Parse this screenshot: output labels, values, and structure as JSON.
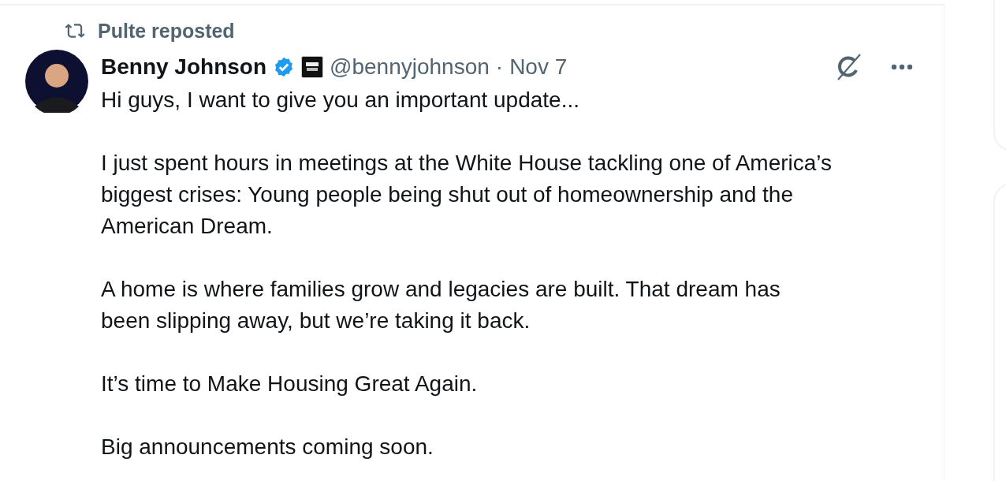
{
  "repost": {
    "text": "Pulte reposted"
  },
  "post": {
    "author": "Benny Johnson",
    "verified": true,
    "handle": "@bennyjohnson",
    "separator": "·",
    "date": "Nov 7",
    "paragraphs": [
      "Hi guys, I want to give you an important update...",
      "I just spent hours in meetings at the White House tackling one of America’s biggest crises: Young people being shut out of homeownership and the American Dream.",
      "A home is where families grow and legacies are built. That dream has been slipping away, but we’re taking it back.",
      "It’s time to Make Housing Great Again.",
      "Big announcements coming soon."
    ]
  }
}
